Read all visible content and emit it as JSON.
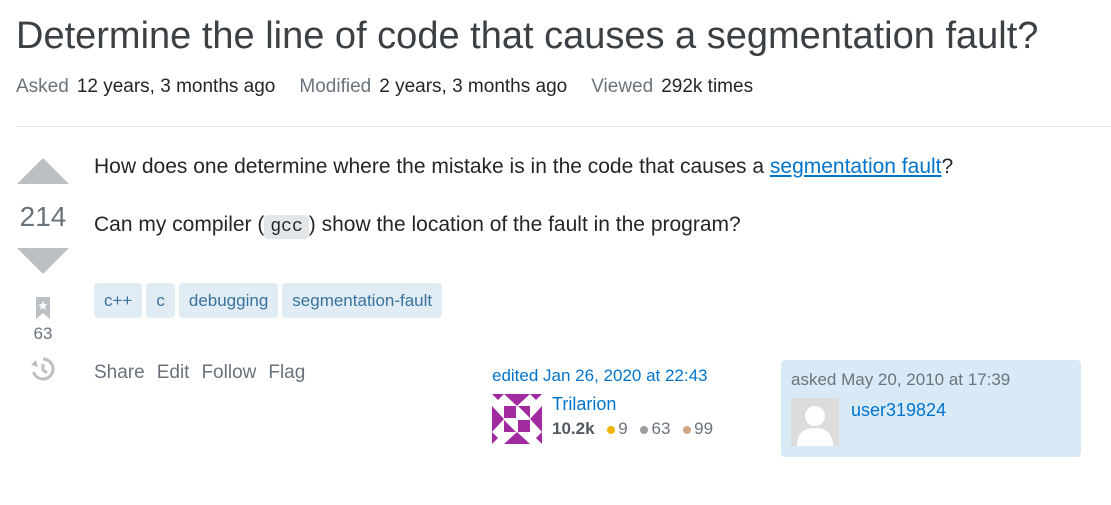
{
  "question": {
    "title": "Determine the line of code that causes a segmentation fault?",
    "meta": {
      "asked_label": "Asked",
      "asked_value": "12 years, 3 months ago",
      "modified_label": "Modified",
      "modified_value": "2 years, 3 months ago",
      "viewed_label": "Viewed",
      "viewed_value": "292k times"
    },
    "score": "214",
    "bookmark_count": "63",
    "body": {
      "p1_before": "How does one determine where the mistake is in the code that causes a ",
      "p1_link": "segmentation fault",
      "p1_after": "?",
      "p2_before": "Can my compiler (",
      "p2_code": "gcc",
      "p2_after": ") show the location of the fault in the program?"
    },
    "tags": [
      "c++",
      "c",
      "debugging",
      "segmentation-fault"
    ],
    "actions": [
      "Share",
      "Edit",
      "Follow",
      "Flag"
    ]
  },
  "editor": {
    "edited": "edited Jan 26, 2020 at 22:43",
    "name": "Trilarion",
    "reputation": "10.2k",
    "gold": "9",
    "silver": "63",
    "bronze": "99"
  },
  "asker": {
    "asked": "asked May 20, 2010 at 17:39",
    "name": "user319824"
  },
  "colors": {
    "link": "#0074cc",
    "tag_bg": "#e1ecf4",
    "tag_text": "#39739d",
    "owner_bg": "#d9eaf7",
    "gold": "#f1b600",
    "silver": "#9a9da0",
    "bronze": "#d1a684",
    "identicon": "#a02ba0"
  }
}
